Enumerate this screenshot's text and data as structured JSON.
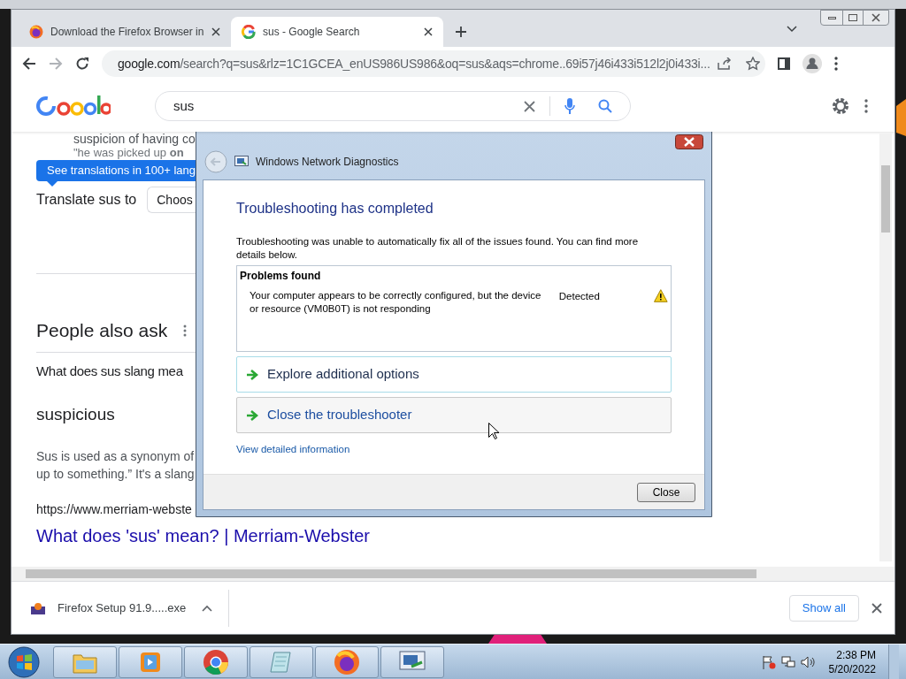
{
  "browser": {
    "tabs": [
      {
        "title": "Download the Firefox Browser in",
        "kind": "firefox",
        "selected": false
      },
      {
        "title": "sus - Google Search",
        "kind": "google",
        "selected": true
      }
    ],
    "address": {
      "host": "google.com",
      "path": "/search?q=sus&rlz=1C1GCEA_enUS986US986&oq=sus&aqs=chrome..69i57j46i433i512l2j0i433i..."
    }
  },
  "google": {
    "query": "sus",
    "snippet_lines": [
      "suspicion of having co",
      "\"he was picked up **on**"
    ],
    "translations_chip": "See translations in 100+ lang",
    "translate_label": "Translate sus to",
    "language_select": "Choos",
    "people_also_ask": "People also ask",
    "question": "What does sus slang mea",
    "answer_title": "suspicious",
    "answer_lines": [
      "Sus is used as a synonym of",
      "up to something.” It's a slang"
    ],
    "source_url": "https://www.merriam-webste",
    "result_link": "What does 'sus' mean? | Merriam-Webster"
  },
  "dialog": {
    "title": "Windows Network Diagnostics",
    "heading": "Troubleshooting has completed",
    "message": "Troubleshooting was unable to automatically fix all of the issues found. You can find more details below.",
    "problems_heading": "Problems found",
    "problems": [
      {
        "description": "Your computer appears to be correctly configured, but the device or resource (VM0B0T) is not responding",
        "status": "Detected"
      }
    ],
    "options": [
      {
        "label": "Explore additional options",
        "highlighted": true
      },
      {
        "label": "Close the troubleshooter",
        "highlighted": false
      }
    ],
    "details_link": "View detailed information",
    "close_button": "Close"
  },
  "downloads": {
    "file": "Firefox Setup 91.9.....exe",
    "show_all": "Show all"
  },
  "taskbar": {
    "apps": [
      {
        "kind": "folder"
      },
      {
        "kind": "media"
      },
      {
        "kind": "chrome"
      },
      {
        "kind": "notepad"
      },
      {
        "kind": "firefox"
      },
      {
        "kind": "diagnostics"
      }
    ],
    "time": "2:38 PM",
    "date": "5/20/2022"
  }
}
